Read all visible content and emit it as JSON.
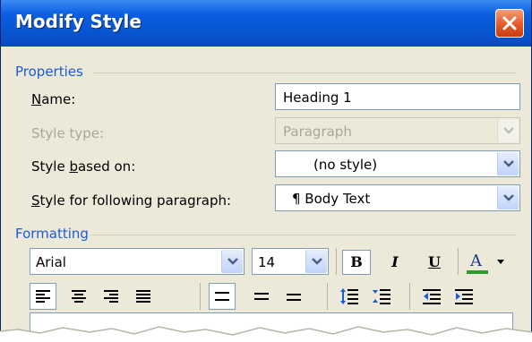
{
  "dialog": {
    "title": "Modify Style"
  },
  "properties": {
    "heading": "Properties",
    "name_label": "Name:",
    "name_value": "Heading 1",
    "style_type_label": "Style type:",
    "style_type_value": "Paragraph",
    "based_on_label": "Style based on:",
    "based_on_value": "(no style)",
    "following_label": "Style for following paragraph:",
    "following_value": "¶ Body Text"
  },
  "formatting": {
    "heading": "Formatting",
    "font": "Arial",
    "size": "14",
    "bold": "B",
    "italic": "I",
    "underline": "U",
    "font_color_letter": "A",
    "font_color": "#2e9a2e"
  },
  "colors": {
    "accent": "#1a5bd6",
    "titlebar": "#0854d0",
    "close": "#e5592d"
  }
}
